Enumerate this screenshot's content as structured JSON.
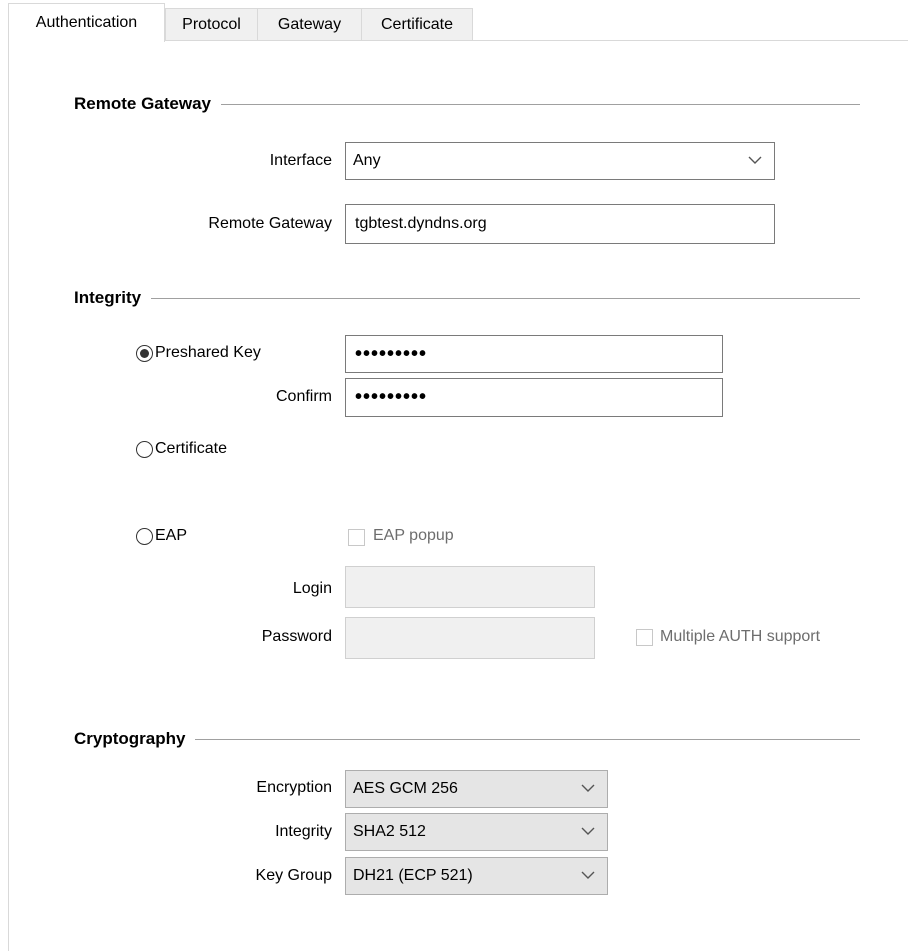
{
  "tabs": [
    {
      "label": "Authentication",
      "active": true
    },
    {
      "label": "Protocol",
      "active": false
    },
    {
      "label": "Gateway",
      "active": false
    },
    {
      "label": "Certificate",
      "active": false
    }
  ],
  "remote_gateway": {
    "title": "Remote Gateway",
    "interface_label": "Interface",
    "interface_value": "Any",
    "gateway_label": "Remote Gateway",
    "gateway_value": "tgbtest.dyndns.org"
  },
  "integrity": {
    "title": "Integrity",
    "preshared_label": "Preshared Key",
    "preshared_value": "•••••••••",
    "confirm_label": "Confirm",
    "confirm_value": "•••••••••",
    "certificate_label": "Certificate",
    "eap_label": "EAP",
    "eap_popup_label": "EAP popup",
    "login_label": "Login",
    "login_value": "",
    "password_label": "Password",
    "password_value": "",
    "multiple_auth_label": "Multiple AUTH support",
    "selected": "preshared"
  },
  "cryptography": {
    "title": "Cryptography",
    "encryption_label": "Encryption",
    "encryption_value": "AES GCM 256",
    "integrity_label": "Integrity",
    "integrity_value": "SHA2 512",
    "keygroup_label": "Key Group",
    "keygroup_value": "DH21 (ECP 521)"
  },
  "icons": {
    "dropdown": "chevron-down-icon"
  }
}
